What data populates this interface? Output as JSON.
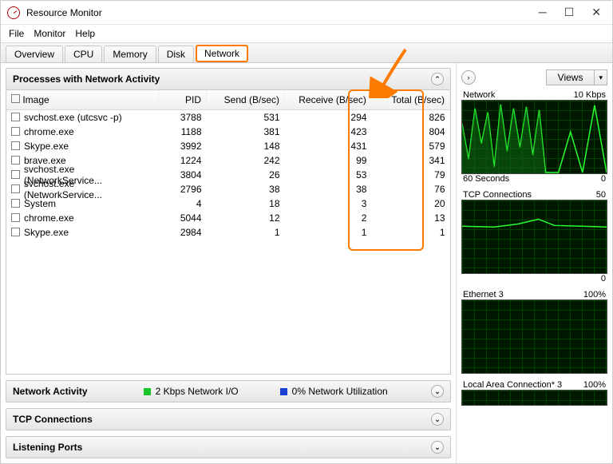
{
  "window": {
    "title": "Resource Monitor"
  },
  "menu": {
    "file": "File",
    "monitor": "Monitor",
    "help": "Help"
  },
  "tabs": {
    "overview": "Overview",
    "cpu": "CPU",
    "memory": "Memory",
    "disk": "Disk",
    "network": "Network"
  },
  "panels": {
    "processes": "Processes with Network Activity",
    "netactivity": "Network Activity",
    "tcp": "TCP Connections",
    "listening": "Listening Ports"
  },
  "columns": {
    "image": "Image",
    "pid": "PID",
    "send": "Send (B/sec)",
    "receive": "Receive (B/sec)",
    "total": "Total (B/sec)"
  },
  "rows": [
    {
      "image": "svchost.exe (utcsvc -p)",
      "pid": "3788",
      "send": "531",
      "recv": "294",
      "total": "826"
    },
    {
      "image": "chrome.exe",
      "pid": "1188",
      "send": "381",
      "recv": "423",
      "total": "804"
    },
    {
      "image": "Skype.exe",
      "pid": "3992",
      "send": "148",
      "recv": "431",
      "total": "579"
    },
    {
      "image": "brave.exe",
      "pid": "1224",
      "send": "242",
      "recv": "99",
      "total": "341"
    },
    {
      "image": "svchost.exe (NetworkService...",
      "pid": "3804",
      "send": "26",
      "recv": "53",
      "total": "79"
    },
    {
      "image": "svchost.exe (NetworkService...",
      "pid": "2796",
      "send": "38",
      "recv": "38",
      "total": "76"
    },
    {
      "image": "System",
      "pid": "4",
      "send": "18",
      "recv": "3",
      "total": "20"
    },
    {
      "image": "chrome.exe",
      "pid": "5044",
      "send": "12",
      "recv": "2",
      "total": "13"
    },
    {
      "image": "Skype.exe",
      "pid": "2984",
      "send": "1",
      "recv": "1",
      "total": "1"
    }
  ],
  "netactivity": {
    "io": "2 Kbps Network I/O",
    "util": "0% Network Utilization"
  },
  "views_label": "Views",
  "graphs": {
    "g1": {
      "title": "Network",
      "right": "10 Kbps",
      "footL": "60 Seconds",
      "footR": "0"
    },
    "g2": {
      "title": "TCP Connections",
      "right": "50",
      "footR": "0"
    },
    "g3": {
      "title": "Ethernet 3",
      "right": "100%"
    },
    "g4": {
      "title": "Local Area Connection* 3",
      "right": "100%"
    }
  }
}
